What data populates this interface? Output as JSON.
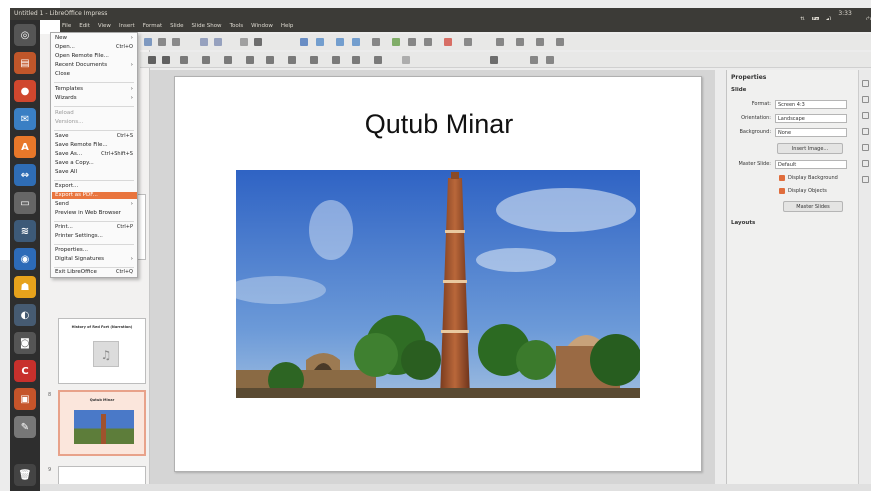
{
  "window": {
    "title": "Untitled 1 - LibreOffice Impress",
    "clock": "3:33 PM"
  },
  "menubar": [
    "File",
    "Edit",
    "View",
    "Insert",
    "Format",
    "Slide",
    "Slide Show",
    "Tools",
    "Window",
    "Help"
  ],
  "file_menu": [
    {
      "label": "New",
      "submenu": true
    },
    {
      "label": "Open...",
      "shortcut": "Ctrl+O"
    },
    {
      "label": "Open Remote File..."
    },
    {
      "label": "Recent Documents",
      "submenu": true
    },
    {
      "label": "Close"
    },
    {
      "label": "Templates",
      "submenu": true
    },
    {
      "label": "Wizards",
      "submenu": true
    },
    {
      "label": "Reload",
      "disabled": true
    },
    {
      "label": "Versions...",
      "disabled": true
    },
    {
      "label": "Save",
      "shortcut": "Ctrl+S"
    },
    {
      "label": "Save Remote File..."
    },
    {
      "label": "Save As...",
      "shortcut": "Ctrl+Shift+S"
    },
    {
      "label": "Save a Copy..."
    },
    {
      "label": "Save All"
    },
    {
      "label": "Export..."
    },
    {
      "label": "Export as PDF...",
      "highlighted": true
    },
    {
      "label": "Send",
      "submenu": true
    },
    {
      "label": "Preview in Web Browser"
    },
    {
      "label": "Print...",
      "shortcut": "Ctrl+P"
    },
    {
      "label": "Printer Settings..."
    },
    {
      "label": "Properties..."
    },
    {
      "label": "Digital Signatures",
      "submenu": true
    },
    {
      "label": "Exit LibreOffice",
      "shortcut": "Ctrl+Q"
    }
  ],
  "slide_panel": {
    "thumbnails": [
      {
        "number": "",
        "title": ""
      },
      {
        "number": "",
        "title": "History of Red Fort (Narration)"
      },
      {
        "number": "8",
        "title": "Qutub Minar",
        "selected": true
      },
      {
        "number": "9",
        "title": ""
      }
    ]
  },
  "slide": {
    "title": "Qutub Minar"
  },
  "properties": {
    "header": "Properties",
    "section_slide": "Slide",
    "format_label": "Format:",
    "format_value": "Screen 4:3",
    "orientation_label": "Orientation:",
    "orientation_value": "Landscape",
    "background_label": "Background:",
    "background_value": "None",
    "insert_image_label": "Insert Image...",
    "master_slide_label": "Master Slide:",
    "master_slide_value": "Default",
    "display_background_label": "Display Background",
    "display_objects_label": "Display Objects",
    "master_slides_button": "Master Slides",
    "section_layouts": "Layouts"
  },
  "colors": {
    "accent": "#e9753e",
    "topbar": "#3c3b37",
    "launcher": "#2e2e2e"
  }
}
